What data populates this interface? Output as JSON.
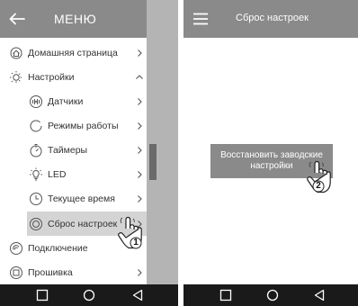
{
  "left_screen": {
    "header": {
      "title": "МЕНЮ",
      "back_icon": "arrow-left-icon"
    },
    "menu": [
      {
        "id": "home",
        "label": "Домашняя страница",
        "icon": "home-icon",
        "level": 1,
        "arrow": "chevron-right"
      },
      {
        "id": "settings",
        "label": "Настройки",
        "icon": "settings-sun-icon",
        "level": 1,
        "arrow": "chevron-up"
      },
      {
        "id": "sensors",
        "label": "Датчики",
        "icon": "sensors-icon",
        "level": 2,
        "arrow": "chevron-right"
      },
      {
        "id": "modes",
        "label": "Режимы работы",
        "icon": "modes-icon",
        "level": 2,
        "arrow": "chevron-right"
      },
      {
        "id": "timers",
        "label": "Таймеры",
        "icon": "timer-icon",
        "level": 2,
        "arrow": "chevron-right"
      },
      {
        "id": "led",
        "label": "LED",
        "icon": "bulb-icon",
        "level": 2,
        "arrow": "chevron-right"
      },
      {
        "id": "time",
        "label": "Текущее время",
        "icon": "clock-icon",
        "level": 2,
        "arrow": "chevron-right"
      },
      {
        "id": "reset",
        "label": "Сброс настроек",
        "icon": "reset-icon",
        "level": 2,
        "arrow": "chevron-right",
        "selected": true
      },
      {
        "id": "connection",
        "label": "Подключение",
        "icon": "connection-icon",
        "level": 1,
        "arrow": ""
      },
      {
        "id": "firmware",
        "label": "Прошивка",
        "icon": "firmware-icon",
        "level": 1,
        "arrow": "chevron-right"
      }
    ],
    "step_number": "1"
  },
  "right_screen": {
    "header": {
      "title": "Сброс настроек",
      "menu_icon": "hamburger-icon"
    },
    "button": {
      "line1": "Восстановить заводские",
      "line2": "настройки"
    },
    "step_number": "2"
  },
  "navbar": {
    "icons": [
      "square-icon",
      "circle-icon",
      "triangle-back-icon"
    ]
  },
  "colors": {
    "header": "#8a8a8a",
    "selected": "#d4d4d4",
    "navbar": "#1a1a1a",
    "overlay": "#b4b4b4"
  }
}
